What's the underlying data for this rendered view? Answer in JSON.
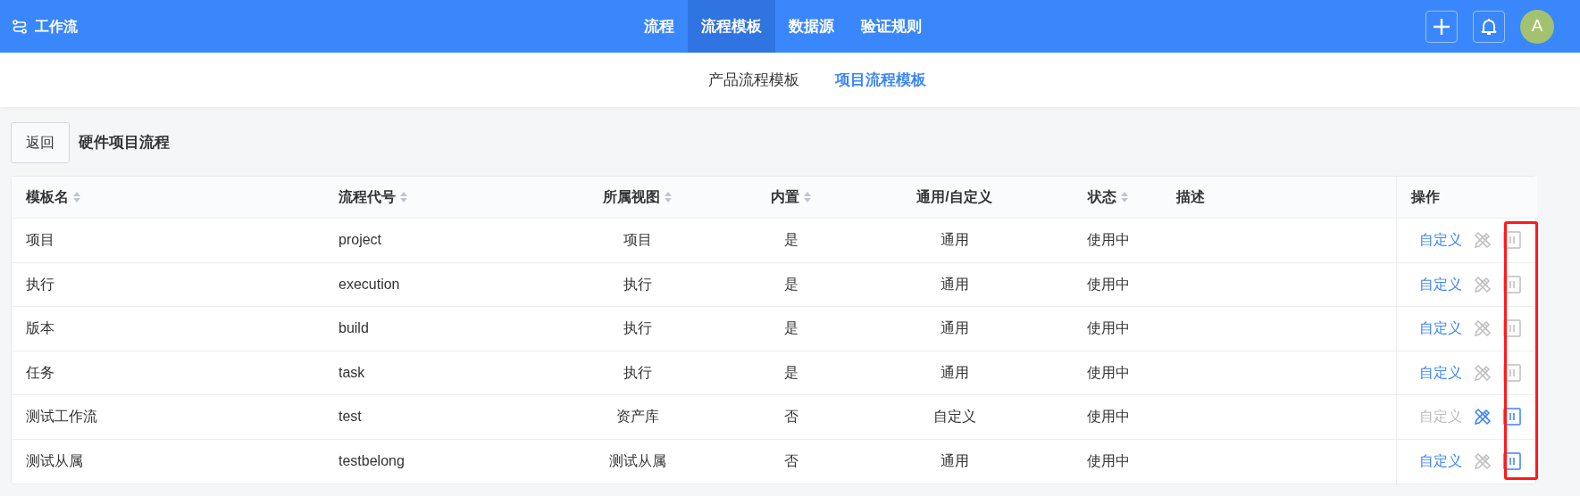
{
  "app": {
    "title": "工作流"
  },
  "nav": [
    {
      "label": "流程",
      "selected": false
    },
    {
      "label": "流程模板",
      "selected": true
    },
    {
      "label": "数据源",
      "selected": false
    },
    {
      "label": "验证规则",
      "selected": false
    }
  ],
  "user": {
    "avatar": "A"
  },
  "subtabs": [
    {
      "label": "产品流程模板",
      "selected": false
    },
    {
      "label": "项目流程模板",
      "selected": true
    }
  ],
  "back_button": "返回",
  "page_title": "硬件项目流程",
  "table": {
    "columns": [
      {
        "label": "模板名",
        "sortable": true
      },
      {
        "label": "流程代号",
        "sortable": true
      },
      {
        "label": "所属视图",
        "sortable": true
      },
      {
        "label": "内置",
        "sortable": true
      },
      {
        "label": "通用/自定义",
        "sortable": false
      },
      {
        "label": "状态",
        "sortable": true
      },
      {
        "label": "描述",
        "sortable": false
      },
      {
        "label": "操作",
        "sortable": false
      }
    ],
    "rows": [
      {
        "cells": [
          "项目",
          "project",
          "项目",
          "是",
          "通用",
          "使用中"
        ],
        "custom": "自定义",
        "custom_disabled": false,
        "design_active": false,
        "pause_active": false
      },
      {
        "cells": [
          "执行",
          "execution",
          "执行",
          "是",
          "通用",
          "使用中"
        ],
        "custom": "自定义",
        "custom_disabled": false,
        "design_active": false,
        "pause_active": false
      },
      {
        "cells": [
          "版本",
          "build",
          "执行",
          "是",
          "通用",
          "使用中"
        ],
        "custom": "自定义",
        "custom_disabled": false,
        "design_active": false,
        "pause_active": false
      },
      {
        "cells": [
          "任务",
          "task",
          "执行",
          "是",
          "通用",
          "使用中"
        ],
        "custom": "自定义",
        "custom_disabled": false,
        "design_active": false,
        "pause_active": false
      },
      {
        "cells": [
          "测试工作流",
          "test",
          "资产库",
          "否",
          "自定义",
          "使用中"
        ],
        "custom": "自定义",
        "custom_disabled": true,
        "design_active": true,
        "pause_active": true
      },
      {
        "cells": [
          "测试从属",
          "testbelong",
          "测试从属",
          "否",
          "通用",
          "使用中"
        ],
        "custom": "自定义",
        "custom_disabled": false,
        "design_active": false,
        "pause_active": true
      }
    ]
  }
}
